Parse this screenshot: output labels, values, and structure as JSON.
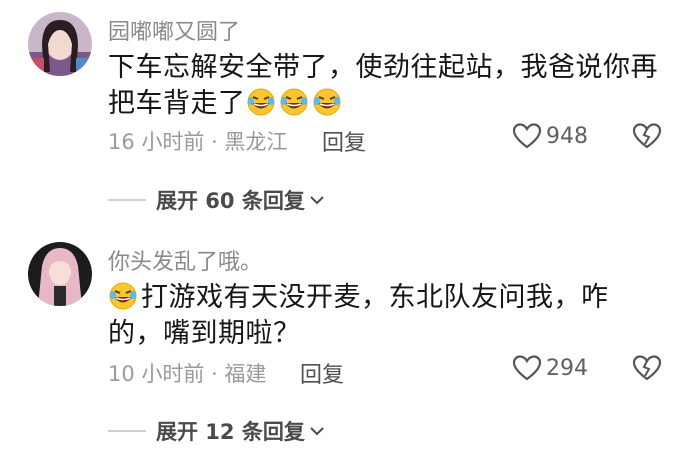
{
  "comments": [
    {
      "username": "园嘟嘟又圆了",
      "text": "下车忘解安全带了，使劲往起站，我爸说你再把车背走了",
      "emoji_count": 3,
      "emoji_position": "suffix",
      "time_location": "16 小时前 · 黑龙江",
      "reply_label": "回复",
      "likes": "948",
      "expand_label": "展开 60 条回复"
    },
    {
      "username": "你头发乱了哦。",
      "text": "打游戏有天没开麦，东北队友问我，咋的，嘴到期啦？",
      "emoji_count": 1,
      "emoji_position": "prefix",
      "time_location": "10 小时前 · 福建",
      "reply_label": "回复",
      "likes": "294",
      "expand_label": "展开 12 条回复"
    }
  ],
  "icons": {
    "emoji": "rolling-laughing-emoji",
    "like": "heart-outline-icon",
    "dislike": "broken-heart-icon",
    "expand": "chevron-down-icon"
  },
  "colors": {
    "text": "#161616",
    "muted": "#9a9a9a",
    "emoji_face": "#fbc531"
  }
}
